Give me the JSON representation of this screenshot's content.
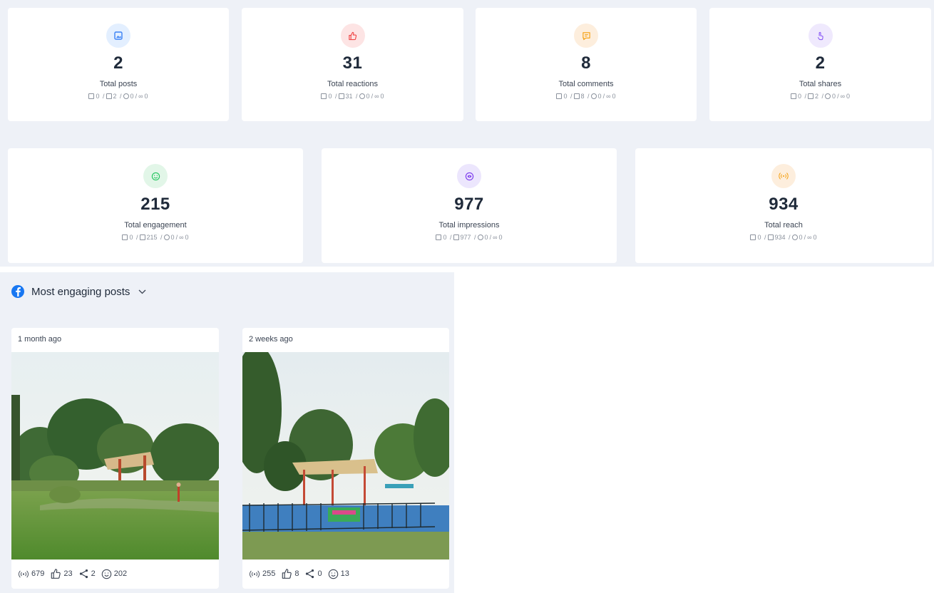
{
  "stats_row1": [
    {
      "icon": "image-icon",
      "color": "#3b82f6",
      "bg": "#e3efff",
      "value": "2",
      "label": "Total posts",
      "breakdown": [
        "0",
        "2",
        "0",
        "0"
      ]
    },
    {
      "icon": "thumbs-up-icon",
      "color": "#ef4444",
      "bg": "#fde4e4",
      "value": "31",
      "label": "Total reactions",
      "breakdown": [
        "0",
        "31",
        "0",
        "0"
      ]
    },
    {
      "icon": "comment-icon",
      "color": "#f59e0b",
      "bg": "#fdeedd",
      "value": "8",
      "label": "Total comments",
      "breakdown": [
        "0",
        "8",
        "0",
        "0"
      ]
    },
    {
      "icon": "share-hand-icon",
      "color": "#8b5cf6",
      "bg": "#efe9fd",
      "value": "2",
      "label": "Total shares",
      "breakdown": [
        "0",
        "2",
        "0",
        "0"
      ]
    }
  ],
  "stats_row2": [
    {
      "icon": "smile-icon",
      "color": "#22c55e",
      "bg": "#e2f6e8",
      "value": "215",
      "label": "Total engagement",
      "breakdown": [
        "0",
        "215",
        "0",
        "0"
      ]
    },
    {
      "icon": "eye-icon",
      "color": "#7c3aed",
      "bg": "#ece6fd",
      "value": "977",
      "label": "Total impressions",
      "breakdown": [
        "0",
        "977",
        "0",
        "0"
      ]
    },
    {
      "icon": "broadcast-icon",
      "color": "#f59e0b",
      "bg": "#fdeedd",
      "value": "934",
      "label": "Total reach",
      "breakdown": [
        "0",
        "934",
        "0",
        "0"
      ]
    }
  ],
  "engaging_posts": {
    "title": "Most engaging posts",
    "posts": [
      {
        "date": "1 month ago",
        "reach": "679",
        "reactions": "23",
        "shares": "2",
        "engagement": "202"
      },
      {
        "date": "2 weeks ago",
        "reach": "255",
        "reactions": "8",
        "shares": "0",
        "engagement": "13"
      }
    ]
  }
}
